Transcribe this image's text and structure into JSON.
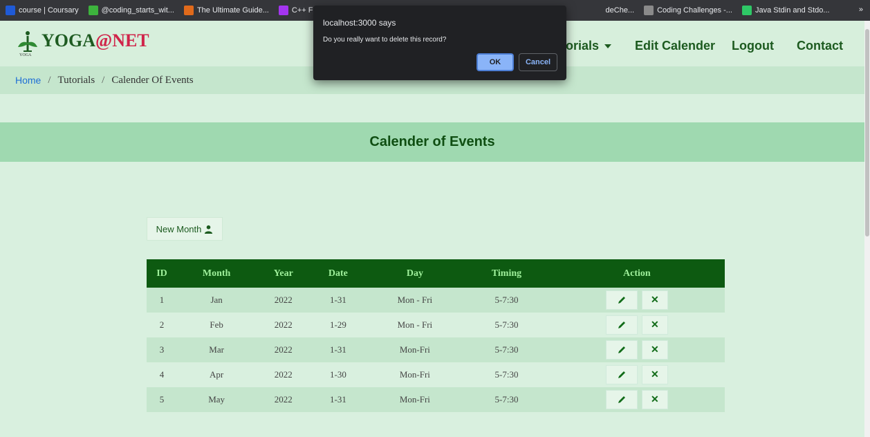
{
  "bookmarks": [
    {
      "label": "course | Coursary",
      "icon": "coursera-icon",
      "color": "#1f5ad6"
    },
    {
      "label": "@coding_starts_wit...",
      "icon": "palm-icon",
      "color": "#3db33d"
    },
    {
      "label": "The Ultimate Guide...",
      "icon": "guide-icon",
      "color": "#e06a1b"
    },
    {
      "label": "C++ For Prog",
      "icon": "udemy-icon",
      "color": "#a435f0"
    },
    {
      "label": "deChe...",
      "icon": "blank-icon",
      "color": "#35363a"
    },
    {
      "label": "Coding Challenges -...",
      "icon": "challenge-icon",
      "color": "#8a8a8a"
    },
    {
      "label": "Java Stdin and Stdo...",
      "icon": "hackerrank-icon",
      "color": "#2ec866"
    }
  ],
  "bookmarks_more": "»",
  "brand": {
    "yoga": "YOGA",
    "at": "@",
    "net": "NET",
    "small": "YOGA"
  },
  "nav": {
    "tutorials": "orials",
    "edit_calender": "Edit Calender",
    "logout": "Logout",
    "contact": "Contact"
  },
  "breadcrumb": {
    "home": "Home",
    "sep": "/",
    "tutorials": "Tutorials",
    "current": "Calender Of Events"
  },
  "section_title": "Calender of Events",
  "new_month": "New Month",
  "table": {
    "headers": [
      "ID",
      "Month",
      "Year",
      "Date",
      "Day",
      "Timing",
      "Action"
    ],
    "rows": [
      [
        "1",
        "Jan",
        "2022",
        "1-31",
        "Mon - Fri",
        "5-7:30"
      ],
      [
        "2",
        "Feb",
        "2022",
        "1-29",
        "Mon - Fri",
        "5-7:30"
      ],
      [
        "3",
        "Mar",
        "2022",
        "1-31",
        "Mon-Fri",
        "5-7:30"
      ],
      [
        "4",
        "Apr",
        "2022",
        "1-30",
        "Mon-Fri",
        "5-7:30"
      ],
      [
        "5",
        "May",
        "2022",
        "1-31",
        "Mon-Fri",
        "5-7:30"
      ]
    ],
    "edit_icon": "pencil-icon",
    "delete_label": "✕"
  },
  "dialog": {
    "title": "localhost:3000 says",
    "message": "Do you really want to delete this record?",
    "ok": "OK",
    "cancel": "Cancel"
  },
  "colors": {
    "header_green": "#0d5a11",
    "brand_red": "#d0244a",
    "dialog_bg": "#202124",
    "ok_blue": "#8ab4f8"
  }
}
